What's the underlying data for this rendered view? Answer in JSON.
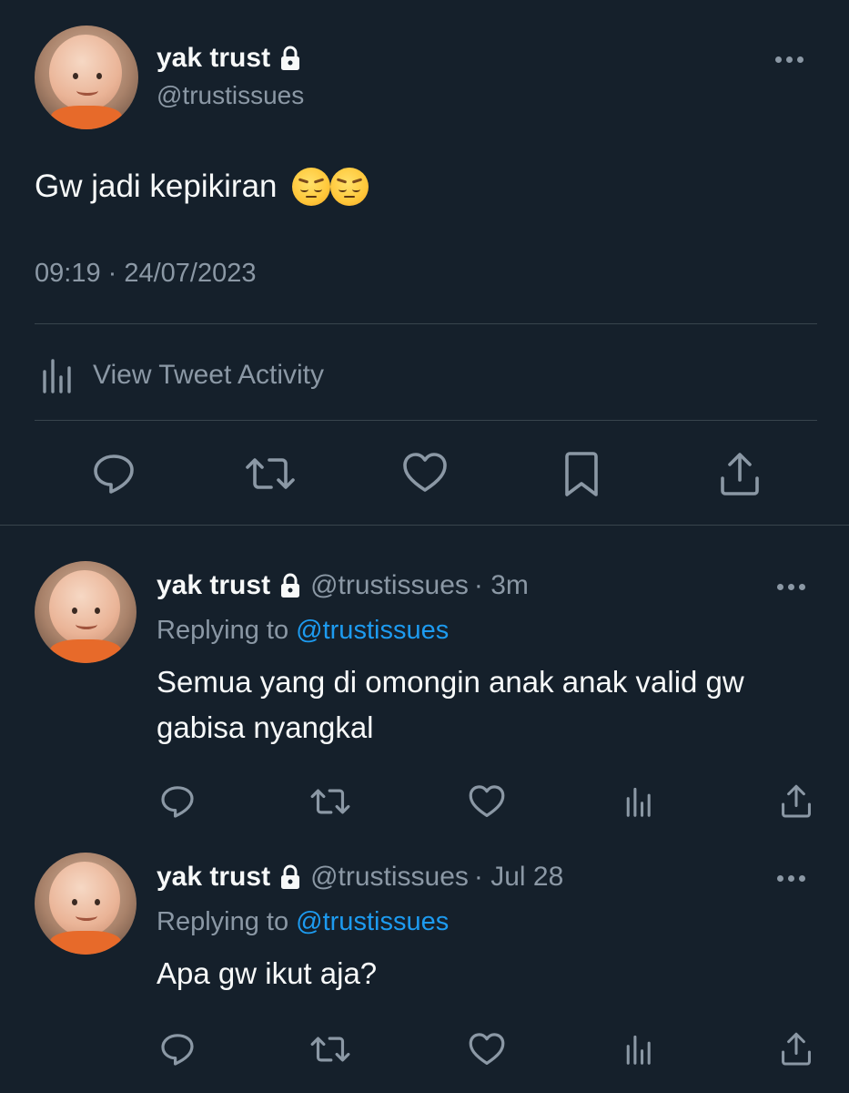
{
  "main_tweet": {
    "display_name": "yak trust",
    "handle": "@trustissues",
    "text": "Gw jadi kepikiran",
    "emoji": [
      "pensive-face",
      "pensive-face"
    ],
    "timestamp": "09:19 · 24/07/2023",
    "activity_label": "View Tweet Activity",
    "actions": [
      "reply-icon",
      "retweet-icon",
      "like-icon",
      "bookmark-icon",
      "share-icon"
    ]
  },
  "replies": [
    {
      "display_name": "yak trust",
      "handle": "@trustissues",
      "time": "· 3m",
      "replying_prefix": "Replying to",
      "replying_to": "@trustissues",
      "text": "Semua yang di omongin anak anak valid gw gabisa nyangkal",
      "actions": [
        "reply-icon",
        "retweet-icon",
        "like-icon",
        "analytics-icon",
        "share-icon"
      ]
    },
    {
      "display_name": "yak trust",
      "handle": "@trustissues",
      "time": "· Jul 28",
      "replying_prefix": "Replying to",
      "replying_to": "@trustissues",
      "text": "Apa gw ikut aja?",
      "actions": [
        "reply-icon",
        "retweet-icon",
        "like-icon",
        "analytics-icon",
        "share-icon"
      ]
    }
  ],
  "colors": {
    "background": "#15202b",
    "text": "#f7f9f9",
    "muted": "#8b98a5",
    "link": "#1d9bf0",
    "divider": "#38444d"
  }
}
